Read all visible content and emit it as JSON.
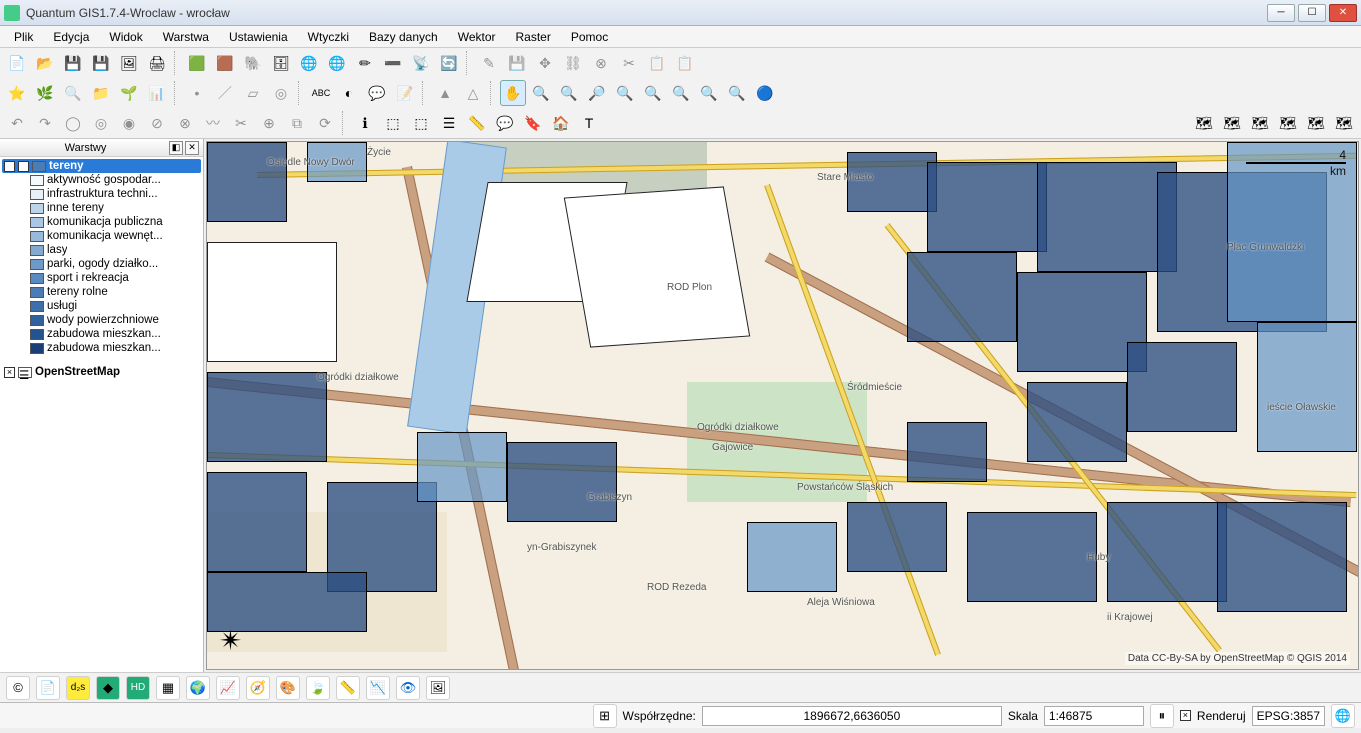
{
  "window": {
    "title": "Quantum GIS1.7.4-Wroclaw - wrocław"
  },
  "menus": [
    "Plik",
    "Edycja",
    "Widok",
    "Warstwa",
    "Ustawienia",
    "Wtyczki",
    "Bazy danych",
    "Wektor",
    "Raster",
    "Pomoc"
  ],
  "panel": {
    "title": "Warstwy"
  },
  "layers": {
    "group": "tereny",
    "items": [
      {
        "label": "aktywność gospodar...",
        "color": "#f5f8fc"
      },
      {
        "label": "infrastruktura techni...",
        "color": "#eaf0f8"
      },
      {
        "label": "inne tereny",
        "color": "#bcd3e8"
      },
      {
        "label": "komunikacja publiczna",
        "color": "#a9c6e2"
      },
      {
        "label": "komunikacja wewnęt...",
        "color": "#98b9da"
      },
      {
        "label": "lasy",
        "color": "#82aad0"
      },
      {
        "label": "parki, ogody działko...",
        "color": "#6d9ac8"
      },
      {
        "label": "sport i rekreacja",
        "color": "#5a8bc0"
      },
      {
        "label": "tereny rolne",
        "color": "#4a7db6"
      },
      {
        "label": "usługi",
        "color": "#3c6fab"
      },
      {
        "label": "wody powierzchniowe",
        "color": "#30619f"
      },
      {
        "label": "zabudowa mieszkan...",
        "color": "#245391"
      },
      {
        "label": "zabudowa mieszkan...",
        "color": "#193f76"
      }
    ],
    "osm": "OpenStreetMap"
  },
  "map": {
    "scale_label": "4",
    "scale_unit": "km",
    "credits": "Data CC-By-SA by OpenStreetMap © QGIS 2014",
    "labels": {
      "stare_miasto": "Stare Miasto",
      "srodmiescie": "Śródmieście",
      "grabiszyn": "Grabiszyn",
      "grabiszynek": "yn-Grabiszynek",
      "huby": "Huby",
      "gajowice": "Gajowice",
      "ogrodki": "Ogródki działkowe",
      "zycie": "Życie",
      "osiedle": "Osiedle Nowy Dwór",
      "reseda": "ROD Rezeda",
      "grunwald": "Plac Grunwaldzki",
      "olawskie": "ieście Oławskie",
      "plon": "ROD Plon",
      "powstancow": "Powstańców Śląskich",
      "wiejska": "Aleja Wiśniowa",
      "ogrodki2": "Ogródki działkowe",
      "krajowej": "ii Krajowej"
    }
  },
  "status": {
    "coord_label": "Współrzędne:",
    "coord_value": "1896672,6636050",
    "scale_label": "Skala",
    "scale_value": "1:46875",
    "render": "Renderuj",
    "crs": "EPSG:3857"
  }
}
